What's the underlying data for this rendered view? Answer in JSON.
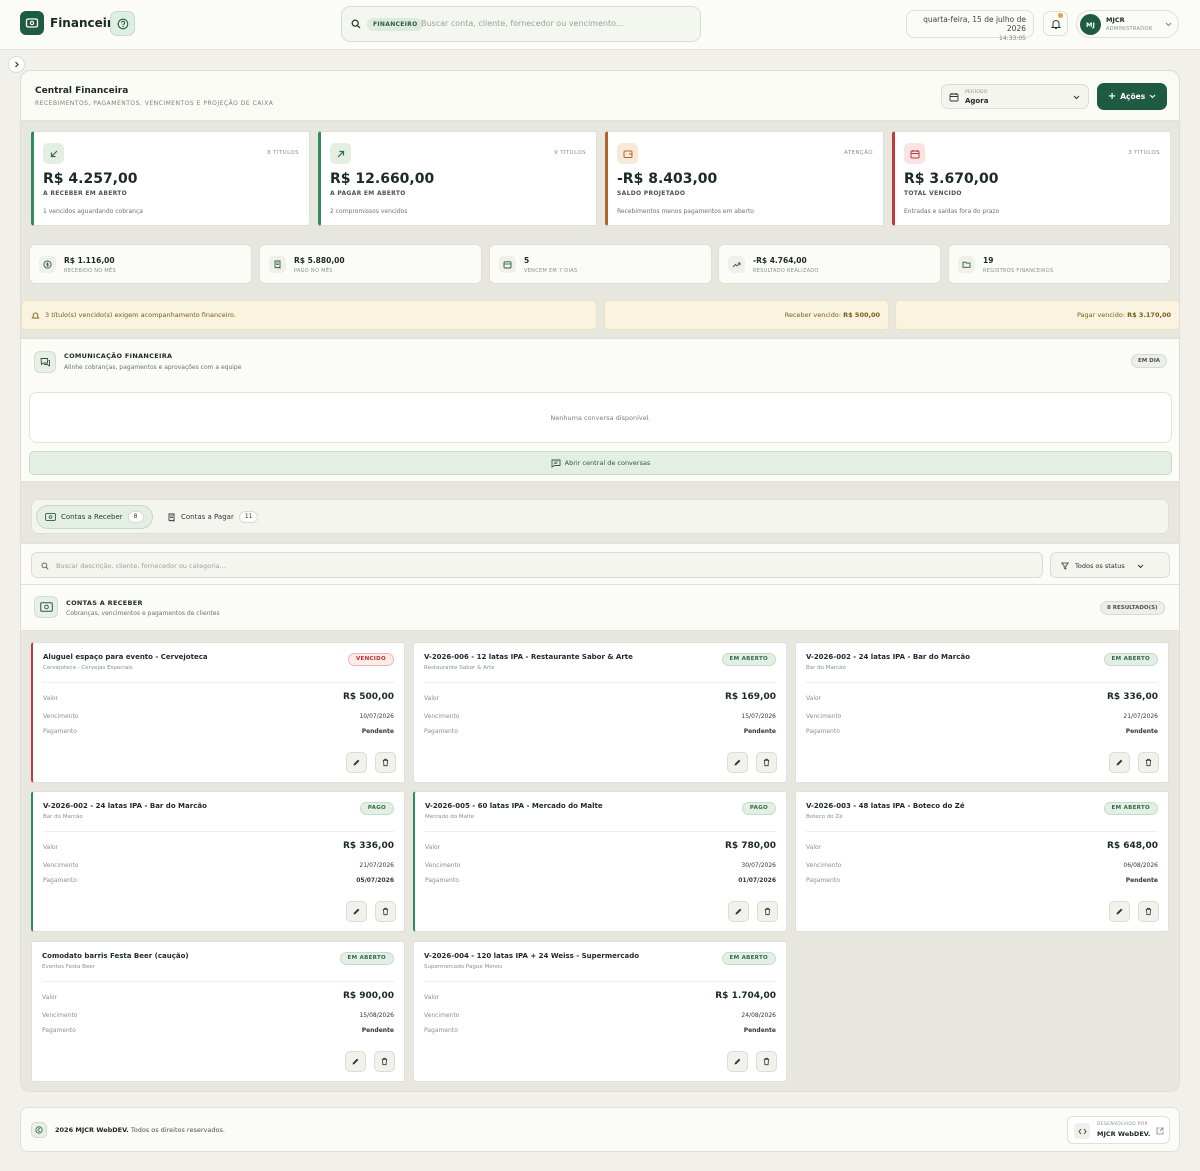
{
  "topbar": {
    "brand": "Financeiro",
    "search_chip": "FINANCEIRO",
    "search_placeholder": "Buscar conta, cliente, fornecedor ou vencimento...",
    "date": "quarta-feira, 15 de julho de 2026",
    "time": "14:33:05",
    "user_initials": "MJ",
    "user_name": "MJCR",
    "user_role": "ADMINISTRADOR"
  },
  "header": {
    "title": "Central Financeira",
    "subtitle": "RECEBIMENTOS, PAGAMENTOS, VENCIMENTOS E PROJEÇÃO DE CAIXA",
    "period_label": "PERÍODO",
    "period_value": "Agora",
    "actions_label": "Ações"
  },
  "kpis": [
    {
      "tag": "8 TÍTULOS",
      "value": "R$ 4.257,00",
      "label": "A RECEBER EM ABERTO",
      "sub": "1 vencidos aguardando cobrança",
      "accent": "#2f8a5c"
    },
    {
      "tag": "9 TÍTULOS",
      "value": "R$ 12.660,00",
      "label": "A PAGAR EM ABERTO",
      "sub": "2 compromissos vencidos",
      "accent": "#2f8a5c"
    },
    {
      "tag": "ATENÇÃO",
      "value": "-R$ 8.403,00",
      "label": "SALDO PROJETADO",
      "sub": "Recebimentos menos pagamentos em aberto",
      "accent": "#b0642a"
    },
    {
      "tag": "3 TÍTULOS",
      "value": "R$ 3.670,00",
      "label": "TOTAL VENCIDO",
      "sub": "Entradas e saídas fora do prazo",
      "accent": "#c0393b"
    }
  ],
  "minis": [
    {
      "value": "R$ 1.116,00",
      "label": "RECEBIDO NO MÊS"
    },
    {
      "value": "R$ 5.880,00",
      "label": "PAGO NO MÊS"
    },
    {
      "value": "5",
      "label": "VENCEM EM 7 DIAS"
    },
    {
      "value": "-R$ 4.764,00",
      "label": "RESULTADO REALIZADO"
    },
    {
      "value": "19",
      "label": "REGISTROS FINANCEIROS"
    }
  ],
  "alerts": {
    "main": "3 título(s) vencido(s) exigem acompanhamento financeiro.",
    "receber_label": "Receber vencido:",
    "receber_value": "R$ 500,00",
    "pagar_label": "Pagar vencido:",
    "pagar_value": "R$ 3.170,00"
  },
  "comm": {
    "title": "COMUNICAÇÃO FINANCEIRA",
    "subtitle": "Alinhe cobranças, pagamentos e aprovações com a equipe",
    "badge": "EM DIA",
    "empty": "Nenhuma conversa disponível.",
    "open_button": "Abrir central de conversas"
  },
  "tabs": [
    {
      "label": "Contas a Receber",
      "count": "8"
    },
    {
      "label": "Contas a Pagar",
      "count": "11"
    }
  ],
  "filters": {
    "search_placeholder": "Buscar descrição, cliente, fornecedor ou categoria...",
    "status": "Todos os status"
  },
  "receivables": {
    "title": "CONTAS A RECEBER",
    "subtitle": "Cobranças, vencimentos e pagamentos de clientes",
    "count": "8 RESULTADO(S)",
    "row_labels": {
      "valor": "Valor",
      "vencimento": "Vencimento",
      "pagamento": "Pagamento"
    },
    "cards": [
      {
        "title": "Aluguel espaço para evento - Cervejoteca",
        "sub": "Cervejoteca - Cervejas Especiais",
        "status": "VENCIDO",
        "valor": "R$ 500,00",
        "vencimento": "10/07/2026",
        "pagamento": "Pendente"
      },
      {
        "title": "V-2026-006 - 12 latas IPA - Restaurante Sabor & Arte",
        "sub": "Restaurante Sabor & Arte",
        "status": "EM ABERTO",
        "valor": "R$ 169,00",
        "vencimento": "15/07/2026",
        "pagamento": "Pendente"
      },
      {
        "title": "V-2026-002 - 24 latas IPA - Bar do Marcão",
        "sub": "Bar do Marcão",
        "status": "EM ABERTO",
        "valor": "R$ 336,00",
        "vencimento": "21/07/2026",
        "pagamento": "Pendente"
      },
      {
        "title": "V-2026-002 - 24 latas IPA - Bar do Marcão",
        "sub": "Bar do Marcão",
        "status": "PAGO",
        "valor": "R$ 336,00",
        "vencimento": "21/07/2026",
        "pagamento": "05/07/2026"
      },
      {
        "title": "V-2026-005 - 60 latas IPA - Mercado do Malte",
        "sub": "Mercado do Malte",
        "status": "PAGO",
        "valor": "R$ 780,00",
        "vencimento": "30/07/2026",
        "pagamento": "01/07/2026"
      },
      {
        "title": "V-2026-003 - 48 latas IPA - Boteco do Zé",
        "sub": "Boteco do Zé",
        "status": "EM ABERTO",
        "valor": "R$ 648,00",
        "vencimento": "06/08/2026",
        "pagamento": "Pendente"
      },
      {
        "title": "Comodato barris Festa Beer (caução)",
        "sub": "Eventos Festa Beer",
        "status": "EM ABERTO",
        "valor": "R$ 900,00",
        "vencimento": "15/08/2026",
        "pagamento": "Pendente"
      },
      {
        "title": "V-2026-004 - 120 latas IPA + 24 Weiss - Supermercado",
        "sub": "Supermercado Pague Menos",
        "status": "EM ABERTO",
        "valor": "R$ 1.704,00",
        "vencimento": "24/08/2026",
        "pagamento": "Pendente"
      }
    ]
  },
  "footer": {
    "brand": "2026 MJCR WebDEV.",
    "rights": "Todos os direitos reservados.",
    "dev_label": "DESENVOLVIDO POR",
    "dev_name": "MJCR WebDEV."
  },
  "colors": {
    "primary": "#1f5a43",
    "success": "#2f8a5c",
    "danger": "#c0393b",
    "warning": "#b0642a"
  }
}
